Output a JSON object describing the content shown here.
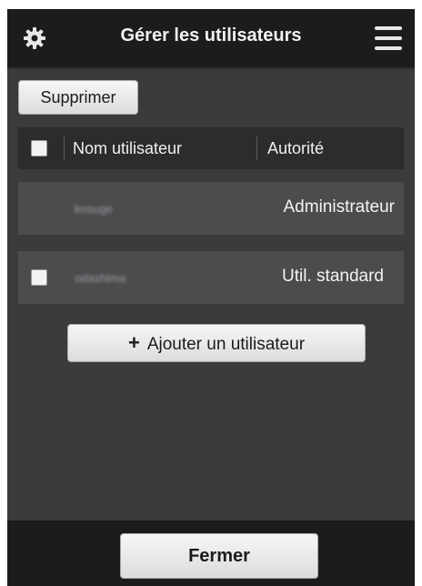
{
  "header": {
    "title": "Gérer les utilisateurs",
    "settings_icon": "gear-icon",
    "menu_icon": "hamburger-menu-icon"
  },
  "toolbar": {
    "delete_label": "Supprimer"
  },
  "table": {
    "columns": [
      "Nom utilisateur",
      "Autorité"
    ],
    "rows": [
      {
        "user": "kosuge",
        "authority": "Administrateur",
        "has_checkbox": false
      },
      {
        "user": "odashima",
        "authority": "Util. standard",
        "has_checkbox": true
      }
    ]
  },
  "add_user": {
    "label": "Ajouter un utilisateur",
    "icon": "plus-icon"
  },
  "footer": {
    "close_label": "Fermer"
  },
  "colors": {
    "header_bg": "#1c1c1c",
    "content_bg": "#3b3b3b",
    "row_bg": "#4c4c4c",
    "button_bg": "#eaeaea"
  }
}
